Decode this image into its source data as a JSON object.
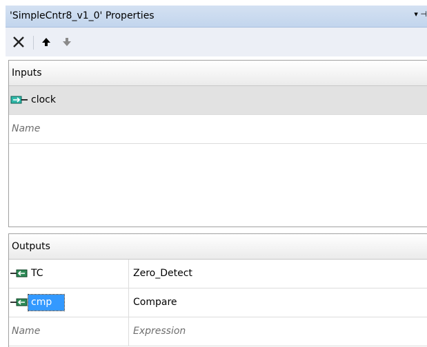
{
  "window": {
    "title": "'SimpleCntr8_v1_0' Properties",
    "pin_glyph": "▾ ⊣"
  },
  "toolbar": {
    "buttons": [
      {
        "icon": "delete-icon"
      },
      {
        "icon": "arrow-up-icon"
      },
      {
        "icon": "arrow-down-icon"
      }
    ]
  },
  "inputs": {
    "header": "Inputs",
    "rows": [
      {
        "name": "clock",
        "icon": "input-pin-icon"
      }
    ],
    "placeholder_name": "Name"
  },
  "outputs": {
    "header": "Outputs",
    "rows": [
      {
        "name": "TC",
        "expression": "Zero_Detect",
        "icon": "output-pin-icon"
      },
      {
        "name": "cmp",
        "expression": "Compare",
        "icon": "output-pin-icon"
      }
    ],
    "placeholder_name": "Name",
    "placeholder_expression": "Expression"
  },
  "colors": {
    "titlebar": "#d4e1f2",
    "toolbar": "#eceff6",
    "selection": "#3399ff",
    "input_pin": "#2fb8a8",
    "output_pin": "#2e8b57"
  }
}
